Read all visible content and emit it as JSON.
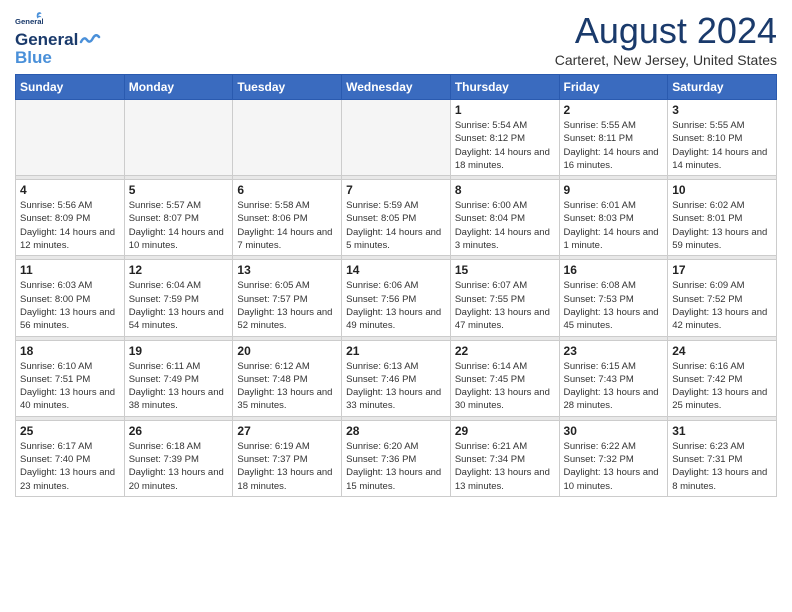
{
  "header": {
    "logo_general": "General",
    "logo_blue": "Blue",
    "month_title": "August 2024",
    "location": "Carteret, New Jersey, United States"
  },
  "days_of_week": [
    "Sunday",
    "Monday",
    "Tuesday",
    "Wednesday",
    "Thursday",
    "Friday",
    "Saturday"
  ],
  "weeks": [
    [
      {
        "day": "",
        "empty": true
      },
      {
        "day": "",
        "empty": true
      },
      {
        "day": "",
        "empty": true
      },
      {
        "day": "",
        "empty": true
      },
      {
        "day": "1",
        "sunrise": "5:54 AM",
        "sunset": "8:12 PM",
        "daylight": "14 hours and 18 minutes."
      },
      {
        "day": "2",
        "sunrise": "5:55 AM",
        "sunset": "8:11 PM",
        "daylight": "14 hours and 16 minutes."
      },
      {
        "day": "3",
        "sunrise": "5:55 AM",
        "sunset": "8:10 PM",
        "daylight": "14 hours and 14 minutes."
      }
    ],
    [
      {
        "day": "4",
        "sunrise": "5:56 AM",
        "sunset": "8:09 PM",
        "daylight": "14 hours and 12 minutes."
      },
      {
        "day": "5",
        "sunrise": "5:57 AM",
        "sunset": "8:07 PM",
        "daylight": "14 hours and 10 minutes."
      },
      {
        "day": "6",
        "sunrise": "5:58 AM",
        "sunset": "8:06 PM",
        "daylight": "14 hours and 7 minutes."
      },
      {
        "day": "7",
        "sunrise": "5:59 AM",
        "sunset": "8:05 PM",
        "daylight": "14 hours and 5 minutes."
      },
      {
        "day": "8",
        "sunrise": "6:00 AM",
        "sunset": "8:04 PM",
        "daylight": "14 hours and 3 minutes."
      },
      {
        "day": "9",
        "sunrise": "6:01 AM",
        "sunset": "8:03 PM",
        "daylight": "14 hours and 1 minute."
      },
      {
        "day": "10",
        "sunrise": "6:02 AM",
        "sunset": "8:01 PM",
        "daylight": "13 hours and 59 minutes."
      }
    ],
    [
      {
        "day": "11",
        "sunrise": "6:03 AM",
        "sunset": "8:00 PM",
        "daylight": "13 hours and 56 minutes."
      },
      {
        "day": "12",
        "sunrise": "6:04 AM",
        "sunset": "7:59 PM",
        "daylight": "13 hours and 54 minutes."
      },
      {
        "day": "13",
        "sunrise": "6:05 AM",
        "sunset": "7:57 PM",
        "daylight": "13 hours and 52 minutes."
      },
      {
        "day": "14",
        "sunrise": "6:06 AM",
        "sunset": "7:56 PM",
        "daylight": "13 hours and 49 minutes."
      },
      {
        "day": "15",
        "sunrise": "6:07 AM",
        "sunset": "7:55 PM",
        "daylight": "13 hours and 47 minutes."
      },
      {
        "day": "16",
        "sunrise": "6:08 AM",
        "sunset": "7:53 PM",
        "daylight": "13 hours and 45 minutes."
      },
      {
        "day": "17",
        "sunrise": "6:09 AM",
        "sunset": "7:52 PM",
        "daylight": "13 hours and 42 minutes."
      }
    ],
    [
      {
        "day": "18",
        "sunrise": "6:10 AM",
        "sunset": "7:51 PM",
        "daylight": "13 hours and 40 minutes."
      },
      {
        "day": "19",
        "sunrise": "6:11 AM",
        "sunset": "7:49 PM",
        "daylight": "13 hours and 38 minutes."
      },
      {
        "day": "20",
        "sunrise": "6:12 AM",
        "sunset": "7:48 PM",
        "daylight": "13 hours and 35 minutes."
      },
      {
        "day": "21",
        "sunrise": "6:13 AM",
        "sunset": "7:46 PM",
        "daylight": "13 hours and 33 minutes."
      },
      {
        "day": "22",
        "sunrise": "6:14 AM",
        "sunset": "7:45 PM",
        "daylight": "13 hours and 30 minutes."
      },
      {
        "day": "23",
        "sunrise": "6:15 AM",
        "sunset": "7:43 PM",
        "daylight": "13 hours and 28 minutes."
      },
      {
        "day": "24",
        "sunrise": "6:16 AM",
        "sunset": "7:42 PM",
        "daylight": "13 hours and 25 minutes."
      }
    ],
    [
      {
        "day": "25",
        "sunrise": "6:17 AM",
        "sunset": "7:40 PM",
        "daylight": "13 hours and 23 minutes."
      },
      {
        "day": "26",
        "sunrise": "6:18 AM",
        "sunset": "7:39 PM",
        "daylight": "13 hours and 20 minutes."
      },
      {
        "day": "27",
        "sunrise": "6:19 AM",
        "sunset": "7:37 PM",
        "daylight": "13 hours and 18 minutes."
      },
      {
        "day": "28",
        "sunrise": "6:20 AM",
        "sunset": "7:36 PM",
        "daylight": "13 hours and 15 minutes."
      },
      {
        "day": "29",
        "sunrise": "6:21 AM",
        "sunset": "7:34 PM",
        "daylight": "13 hours and 13 minutes."
      },
      {
        "day": "30",
        "sunrise": "6:22 AM",
        "sunset": "7:32 PM",
        "daylight": "13 hours and 10 minutes."
      },
      {
        "day": "31",
        "sunrise": "6:23 AM",
        "sunset": "7:31 PM",
        "daylight": "13 hours and 8 minutes."
      }
    ]
  ]
}
